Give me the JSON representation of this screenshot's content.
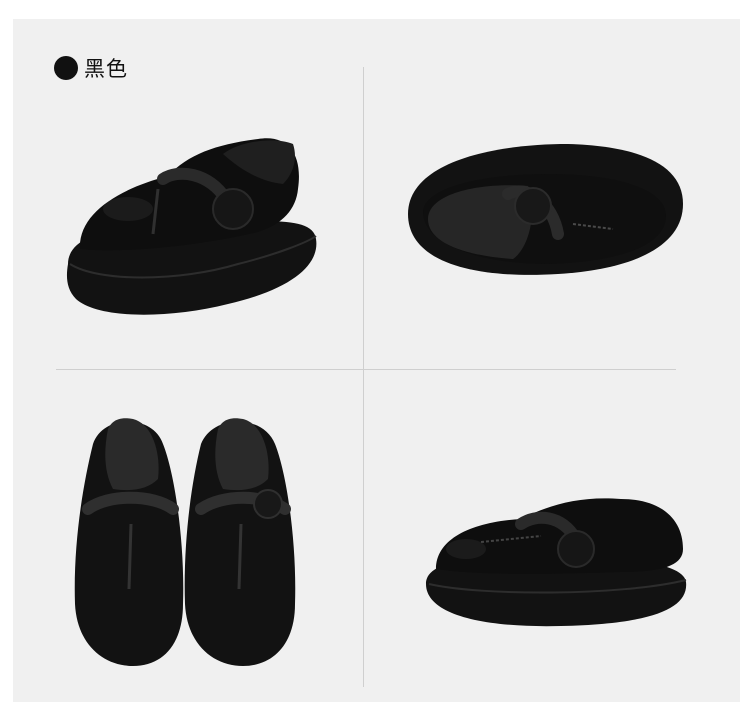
{
  "color_option": {
    "label": "黑色",
    "swatch_color": "#111111"
  },
  "views": [
    {
      "name": "side-front-view"
    },
    {
      "name": "heel-top-view"
    },
    {
      "name": "top-pair-view"
    },
    {
      "name": "side-view"
    }
  ],
  "colors": {
    "background": "#f0f0f0",
    "shoe": "#121212",
    "divider": "#cfcfcf"
  }
}
